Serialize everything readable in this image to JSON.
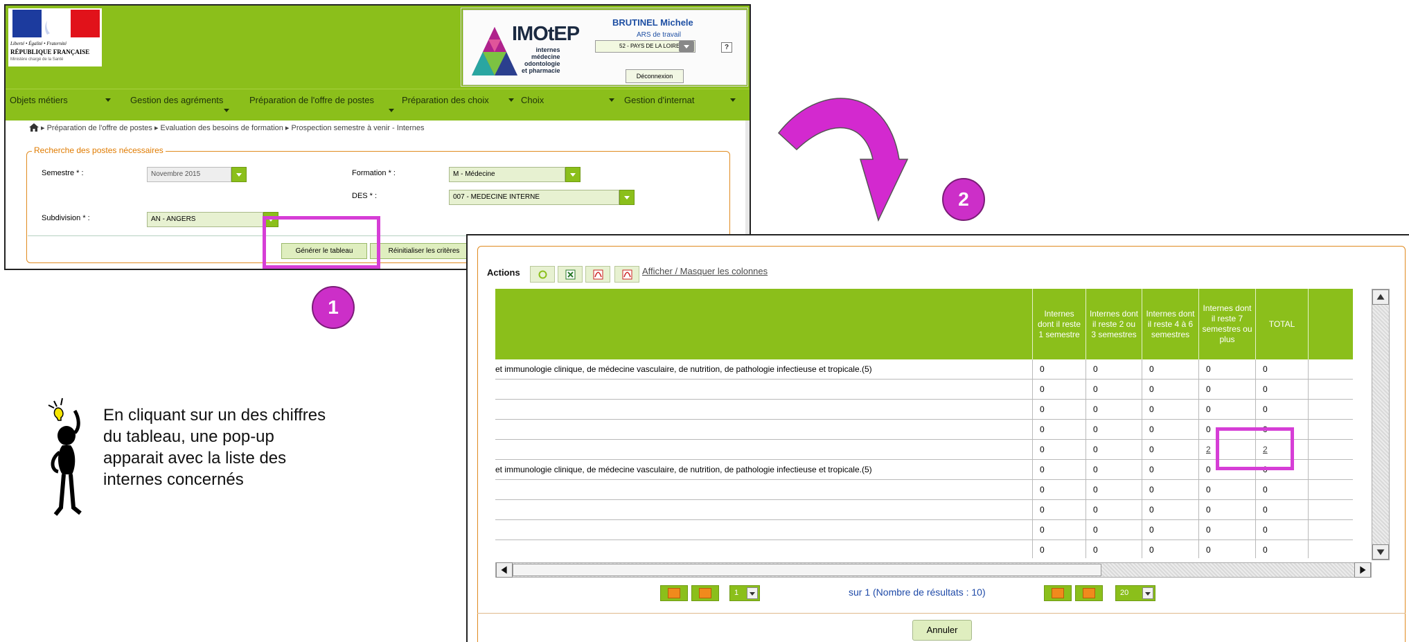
{
  "header": {
    "logo": {
      "motto": "Liberté • Égalité • Fraternité",
      "country": "RÉPUBLIQUE FRANÇAISE",
      "ministry": "Ministère chargé de la Santé"
    },
    "app_name": "IMOtEP",
    "app_subtitle_lines": [
      "internes",
      "médecine",
      "odontologie",
      "et pharmacie"
    ],
    "user_name": "BRUTINEL Michele",
    "user_role": "ARS de travail",
    "region_select": "52 - PAYS DE LA LOIRE",
    "help_label": "?",
    "logout_label": "Déconnexion"
  },
  "menu": [
    {
      "label": "Objets métiers"
    },
    {
      "label": "Gestion des agréments"
    },
    {
      "label": "Préparation de l'offre de postes"
    },
    {
      "label": "Préparation des choix"
    },
    {
      "label": "Choix"
    },
    {
      "label": "Gestion d'internat"
    }
  ],
  "breadcrumb": "▸ Préparation de l'offre de postes ▸ Evaluation des besoins de formation ▸ Prospection semestre à venir - Internes",
  "search_form": {
    "legend": "Recherche des postes nécessaires",
    "semestre_label": "Semestre * :",
    "semestre_value": "Novembre 2015",
    "formation_label": "Formation * :",
    "formation_value": "M - Médecine",
    "des_label": "DES * :",
    "des_value": "007 - MEDECINE INTERNE",
    "subdivision_label": "Subdivision * :",
    "subdivision_value": "AN - ANGERS",
    "generate_label": "Générer le tableau",
    "reset_label": "Réinitialiser les critères"
  },
  "steps": {
    "one": "1",
    "two": "2"
  },
  "results": {
    "actions_label": "Actions",
    "toggle_columns_label": "Afficher / Masquer les colonnes",
    "columns": [
      "Internes dont il reste 1 semestre",
      "Internes dont il reste 2 ou 3 semestres",
      "Internes dont il reste 4 à 6 semestres",
      "Internes dont il reste 7 semestres ou plus",
      "TOTAL"
    ],
    "rows": [
      {
        "desc": "et immunologie clinique, de médecine vasculaire, de nutrition, de pathologie infectieuse et tropicale.(5)",
        "v": [
          "0",
          "0",
          "0",
          "0",
          "0"
        ]
      },
      {
        "desc": "",
        "v": [
          "0",
          "0",
          "0",
          "0",
          "0"
        ]
      },
      {
        "desc": "",
        "v": [
          "0",
          "0",
          "0",
          "0",
          "0"
        ]
      },
      {
        "desc": "",
        "v": [
          "0",
          "0",
          "0",
          "0",
          "0"
        ]
      },
      {
        "desc": "",
        "v": [
          "0",
          "0",
          "0",
          "2",
          "2"
        ]
      },
      {
        "desc": "et immunologie clinique, de médecine vasculaire, de nutrition, de pathologie infectieuse et tropicale.(5)",
        "v": [
          "0",
          "0",
          "0",
          "0",
          "0"
        ]
      },
      {
        "desc": "",
        "v": [
          "0",
          "0",
          "0",
          "0",
          "0"
        ]
      },
      {
        "desc": "",
        "v": [
          "0",
          "0",
          "0",
          "0",
          "0"
        ]
      },
      {
        "desc": "",
        "v": [
          "0",
          "0",
          "0",
          "0",
          "0"
        ]
      },
      {
        "desc": "",
        "v": [
          "0",
          "0",
          "0",
          "0",
          "0"
        ]
      }
    ],
    "pagination": {
      "page": "1",
      "info": "sur 1 (Nombre de résultats : 10)",
      "page_size": "20"
    },
    "cancel_label": "Annuler"
  },
  "tip": "En cliquant sur un des chiffres du tableau, une pop-up apparait avec la liste des internes concernés",
  "colors": {
    "brand_green": "#8bbf1b",
    "highlight_magenta": "#d63ed6",
    "form_orange": "#e08a1e"
  }
}
